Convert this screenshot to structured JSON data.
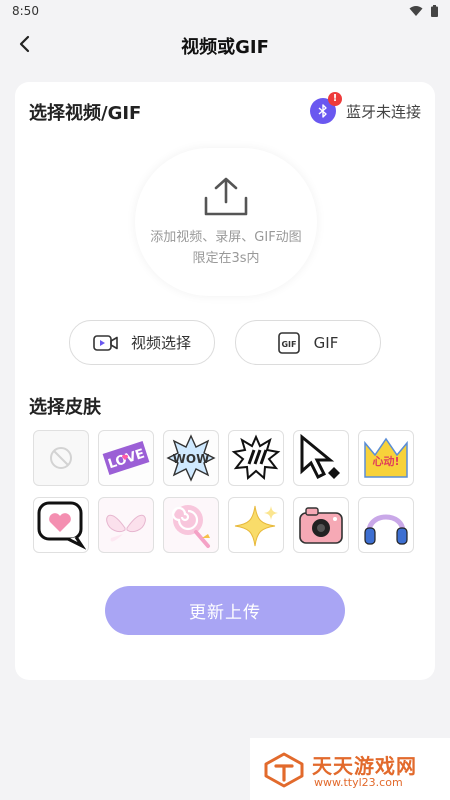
{
  "status_bar": {
    "time": "8:50"
  },
  "header": {
    "title": "视频或GIF"
  },
  "select_video": {
    "title": "选择视频/GIF",
    "bluetooth_status": "蓝牙未连接",
    "upload_line1": "添加视频、录屏、GIF动图",
    "upload_line2": "限定在3s内",
    "video_button": "视频选择",
    "gif_button": "GIF"
  },
  "skins": {
    "title": "选择皮肤",
    "items": [
      {
        "name": "none"
      },
      {
        "name": "love"
      },
      {
        "name": "wow"
      },
      {
        "name": "exclaim-burst"
      },
      {
        "name": "cursor"
      },
      {
        "name": "heart-crown"
      },
      {
        "name": "heart-bubble"
      },
      {
        "name": "wings"
      },
      {
        "name": "lollipop"
      },
      {
        "name": "sparkle"
      },
      {
        "name": "camera"
      },
      {
        "name": "headphones"
      }
    ]
  },
  "update_button": "更新上传",
  "watermark": {
    "brand": "天天游戏网",
    "url": "www.ttyl23.com"
  },
  "colors": {
    "accent": "#6a58f0",
    "update_button": "#a9a5f4",
    "badge": "#ee3b3b",
    "watermark": "#e26a2c"
  }
}
